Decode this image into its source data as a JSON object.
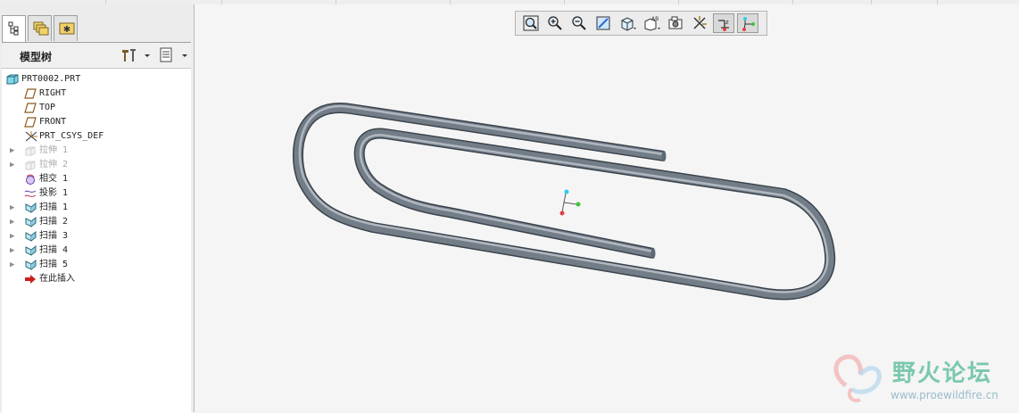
{
  "left_panel": {
    "header_title": "模型树",
    "tree": [
      {
        "label": "PRT0002.PRT",
        "icon": "part-icon",
        "level": 0,
        "expandable": false,
        "dimmed": false
      },
      {
        "label": "RIGHT",
        "icon": "datum-plane-icon",
        "level": 1,
        "expandable": false,
        "dimmed": false
      },
      {
        "label": "TOP",
        "icon": "datum-plane-icon",
        "level": 1,
        "expandable": false,
        "dimmed": false
      },
      {
        "label": "FRONT",
        "icon": "datum-plane-icon",
        "level": 1,
        "expandable": false,
        "dimmed": false
      },
      {
        "label": "PRT_CSYS_DEF",
        "icon": "coordinate-system-icon",
        "level": 1,
        "expandable": false,
        "dimmed": false
      },
      {
        "label": "拉伸 1",
        "icon": "extrude-icon",
        "level": 1,
        "expandable": true,
        "dimmed": true
      },
      {
        "label": "拉伸 2",
        "icon": "extrude-icon",
        "level": 1,
        "expandable": true,
        "dimmed": true
      },
      {
        "label": "相交 1",
        "icon": "intersect-icon",
        "level": 1,
        "expandable": false,
        "dimmed": false
      },
      {
        "label": "投影 1",
        "icon": "projection-icon",
        "level": 1,
        "expandable": false,
        "dimmed": false
      },
      {
        "label": "扫描 1",
        "icon": "sweep-icon",
        "level": 1,
        "expandable": true,
        "dimmed": false
      },
      {
        "label": "扫描 2",
        "icon": "sweep-icon",
        "level": 1,
        "expandable": true,
        "dimmed": false
      },
      {
        "label": "扫描 3",
        "icon": "sweep-icon",
        "level": 1,
        "expandable": true,
        "dimmed": false
      },
      {
        "label": "扫描 4",
        "icon": "sweep-icon",
        "level": 1,
        "expandable": true,
        "dimmed": false
      },
      {
        "label": "扫描 5",
        "icon": "sweep-icon",
        "level": 1,
        "expandable": true,
        "dimmed": false
      },
      {
        "label": "在此插入",
        "icon": "insert-here-arrow-icon",
        "level": 1,
        "expandable": false,
        "dimmed": false
      }
    ]
  },
  "toolbar": {
    "buttons": [
      "zoom-fit-icon",
      "zoom-in-icon",
      "zoom-out-icon",
      "repaint-icon",
      "view-orientation-icon",
      "saved-views-icon",
      "display-style-icon",
      "datum-display-icon",
      "spin-center-icon",
      "csys-display-icon"
    ],
    "pressed": [
      "spin-center-icon",
      "csys-display-icon"
    ]
  },
  "model": {
    "name": "paperclip",
    "color": "#6f7a85"
  },
  "watermark": {
    "text": "野火论坛",
    "url": "www.proewildfire.cn"
  }
}
